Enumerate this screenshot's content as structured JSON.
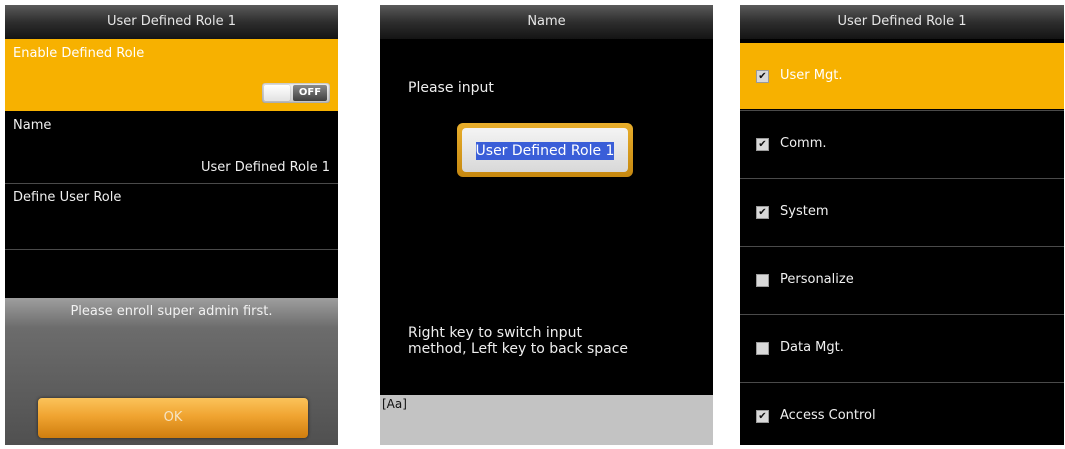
{
  "screen1": {
    "title": "User Defined Role 1",
    "enable_label": "Enable Defined Role",
    "toggle_state": "OFF",
    "name_label": "Name",
    "name_value": "User Defined Role 1",
    "define_label": "Define User Role",
    "dialog_message": "Please enroll super admin first.",
    "ok_label": "OK"
  },
  "screen2": {
    "title": "Name",
    "prompt": "Please input",
    "input_value": "User Defined Role 1",
    "hint_line1": "Right key to switch input",
    "hint_line2": "method, Left key to back space",
    "ime_mode": "[Aa]"
  },
  "screen3": {
    "title": "User Defined Role 1",
    "items": [
      {
        "label": "User Mgt.",
        "checked": true,
        "active": true
      },
      {
        "label": "Comm.",
        "checked": true
      },
      {
        "label": "System",
        "checked": true
      },
      {
        "label": "Personalize",
        "checked": false
      },
      {
        "label": "Data Mgt.",
        "checked": false
      },
      {
        "label": "Access Control",
        "checked": true
      }
    ]
  },
  "colors": {
    "accent": "#f7b100",
    "selection": "#3a5ed8",
    "background": "#000000"
  }
}
